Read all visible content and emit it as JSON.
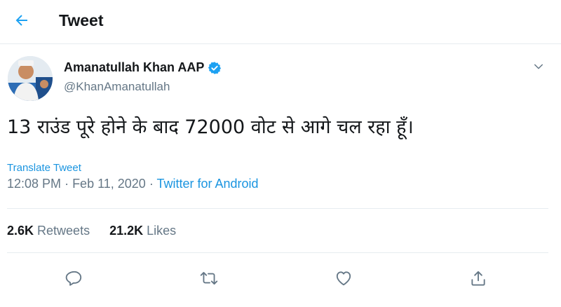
{
  "header": {
    "title": "Tweet",
    "back_icon": "arrow-left-icon"
  },
  "author": {
    "display_name": "Amanatullah Khan AAP",
    "handle": "@KhanAmanatullah",
    "verified": true,
    "verified_color": "#1da1f2"
  },
  "tweet": {
    "text": "13 राउंड पूरे होने के बाद 72000 वोट से आगे चल रहा हूँ।",
    "translate_label": "Translate Tweet",
    "time": "12:08 PM",
    "date": "Feb 11, 2020",
    "source": "Twitter for Android"
  },
  "stats": {
    "retweets_count": "2.6K",
    "retweets_label": "Retweets",
    "likes_count": "21.2K",
    "likes_label": "Likes"
  },
  "actions": [
    "reply-icon",
    "retweet-icon",
    "like-icon",
    "share-icon"
  ],
  "colors": {
    "accent": "#1da1f2",
    "link": "#1b95e0",
    "muted": "#657786",
    "border": "#e6ecf0"
  }
}
